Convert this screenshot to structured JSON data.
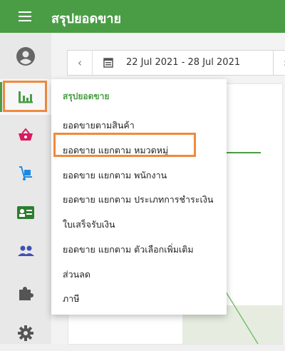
{
  "header": {
    "title": "สรุปยอดขาย"
  },
  "sidebar": {
    "items": [
      {
        "icon": "account-circle-icon"
      },
      {
        "icon": "bar-chart-icon",
        "active": true
      },
      {
        "icon": "basket-icon"
      },
      {
        "icon": "hand-truck-icon"
      },
      {
        "icon": "id-card-icon"
      },
      {
        "icon": "people-icon"
      },
      {
        "icon": "puzzle-icon"
      },
      {
        "icon": "gear-icon"
      }
    ]
  },
  "date_range": {
    "text": "22 Jul 2021 - 28 Jul 2021"
  },
  "report_menu": {
    "header": "สรุปยอดขาย",
    "items": [
      "ยอดขายตามสินค้า",
      "ยอดขาย แยกตาม หมวดหมู่",
      "ยอดขาย แยกตาม พนักงาน",
      "ยอดขาย แยกตาม ประเภทการชำระเงิน",
      "ใบเสร็จรับเงิน",
      "ยอดขาย แยกตาม ตัวเลือกเพิ่มเติม",
      "ส่วนลด",
      "ภาษี"
    ],
    "highlighted_index": 1
  },
  "colors": {
    "primary": "#4a9d45",
    "highlight": "#ee8a3e",
    "basket": "#d81b60",
    "cart": "#1e88e5",
    "card": "#2e7d32",
    "people": "#3f51b5",
    "puzzle": "#555555"
  }
}
